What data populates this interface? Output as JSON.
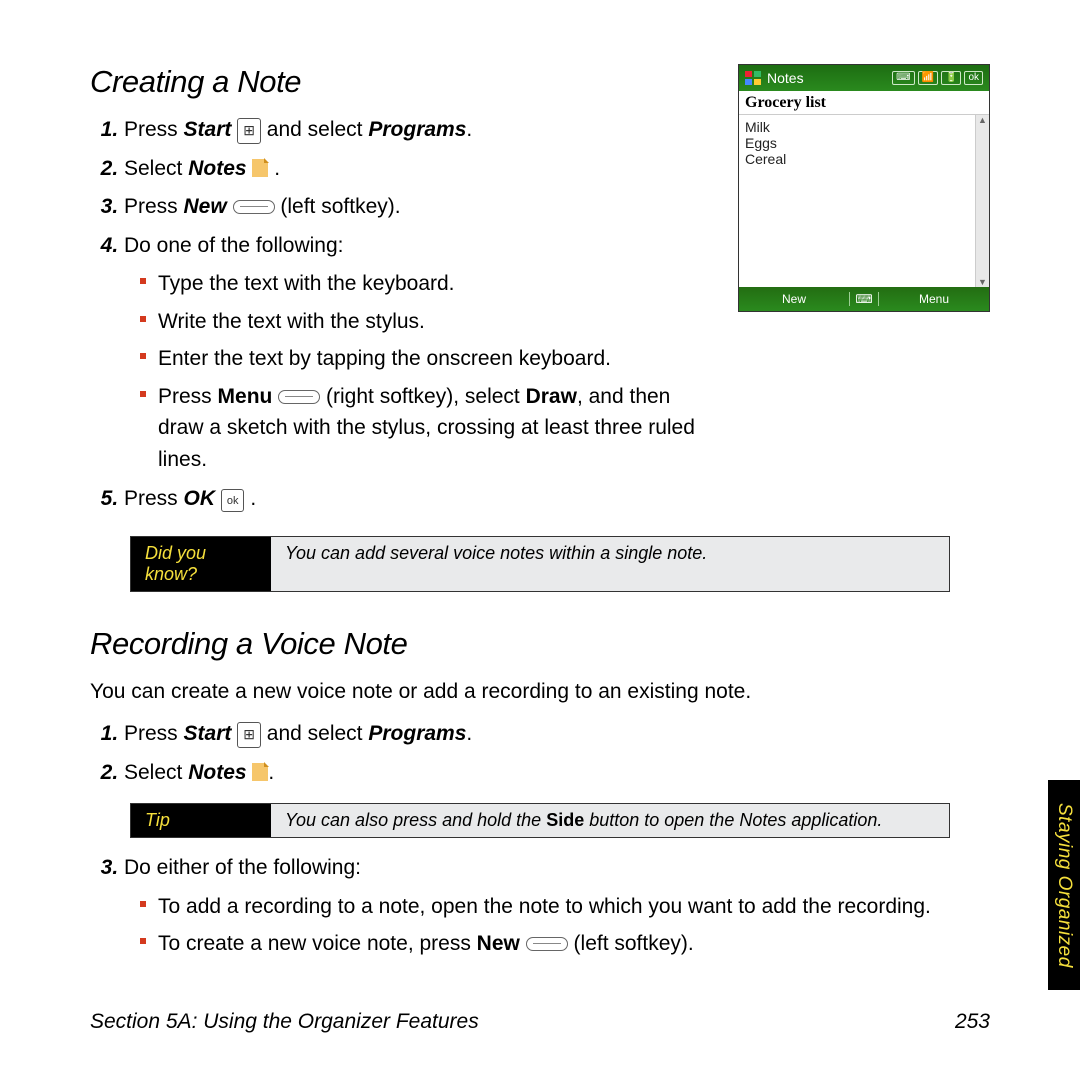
{
  "section1": {
    "title": "Creating a Note",
    "steps": {
      "s1": {
        "pre": "Press ",
        "b1": "Start",
        "mid": " ",
        "post": " and select ",
        "b2": "Programs",
        "tail": "."
      },
      "s2": {
        "pre": "Select ",
        "b1": "Notes",
        "tail": " ."
      },
      "s3": {
        "pre": "Press ",
        "b1": "New",
        "post": " ",
        "tail": " (left softkey)."
      },
      "s4": "Do one of the following:",
      "s4_sub": {
        "a": "Type the text with the keyboard.",
        "b": "Write the text with the stylus.",
        "c": "Enter the text by tapping the onscreen keyboard.",
        "d_pre": "Press ",
        "d_b1": "Menu",
        "d_mid": " ",
        "d_post1": " (right softkey), select ",
        "d_b2": "Draw",
        "d_post2": ", and then draw a sketch with the stylus, crossing at least three ruled lines."
      },
      "s5": {
        "pre": "Press ",
        "b1": "OK",
        "tail": " ."
      }
    }
  },
  "callout1": {
    "label": "Did you know?",
    "body": "You can add several voice notes within a single note."
  },
  "section2": {
    "title": "Recording a Voice Note",
    "intro": "You can create a new voice note or add a recording to an existing note.",
    "steps": {
      "s1": {
        "pre": "Press ",
        "b1": "Start",
        "mid": " ",
        "post": " and select ",
        "b2": "Programs",
        "tail": "."
      },
      "s2": {
        "pre": "Select ",
        "b1": "Notes",
        "tail": "."
      },
      "s3": "Do either of the following:",
      "s3_sub": {
        "a": "To add a recording to a note, open the note to which you want to add the recording.",
        "b_pre": "To create a new voice note, press ",
        "b_b1": "New",
        "b_mid": " ",
        "b_tail": " (left softkey)."
      }
    }
  },
  "callout2": {
    "label": "Tip",
    "body_pre": "You can also press and hold the ",
    "body_b": "Side",
    "body_post": " button to open the Notes application."
  },
  "device": {
    "appTitle": "Notes",
    "okLabel": "ok",
    "trayKbd": "⌨",
    "traySig": "📶",
    "trayBat": "🔋",
    "docTitle": "Grocery list",
    "lines": {
      "l1": "Milk",
      "l2": "Eggs",
      "l3": "Cereal"
    },
    "skLeft": "New",
    "skMid": "⌨",
    "skRight": "Menu"
  },
  "sideTab": "Staying Organized",
  "footer": "Section 5A: Using the Organizer Features",
  "pageNum": "253"
}
